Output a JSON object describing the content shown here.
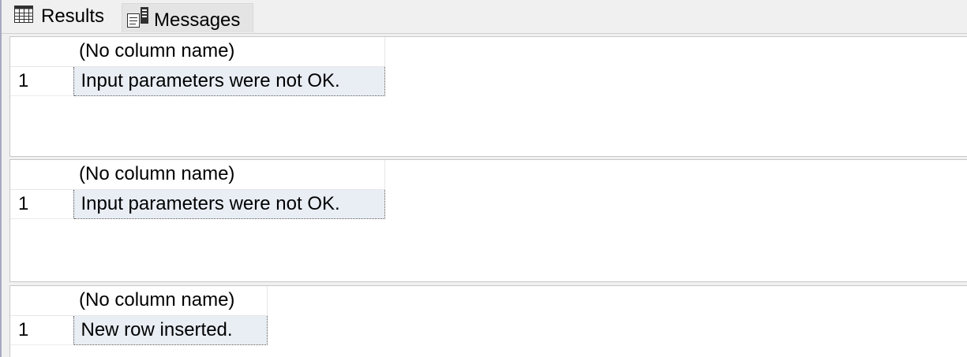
{
  "tabs": {
    "results_label": "Results",
    "results_icon": "grid-icon",
    "messages_label": "Messages",
    "messages_icon": "messages-icon"
  },
  "result_sets": [
    {
      "columns": [
        "(No column name)"
      ],
      "rows": [
        {
          "row_number": "1",
          "cells": [
            "Input parameters were not OK."
          ]
        }
      ]
    },
    {
      "columns": [
        "(No column name)"
      ],
      "rows": [
        {
          "row_number": "1",
          "cells": [
            "Input parameters were not OK."
          ]
        }
      ]
    },
    {
      "columns": [
        "(No column name)"
      ],
      "rows": [
        {
          "row_number": "1",
          "cells": [
            "New row inserted."
          ]
        }
      ]
    }
  ],
  "colors": {
    "selected_cell_bg": "#e9eef5",
    "pane_bg": "#ffffff",
    "chrome_bg": "#f0f0f0"
  }
}
